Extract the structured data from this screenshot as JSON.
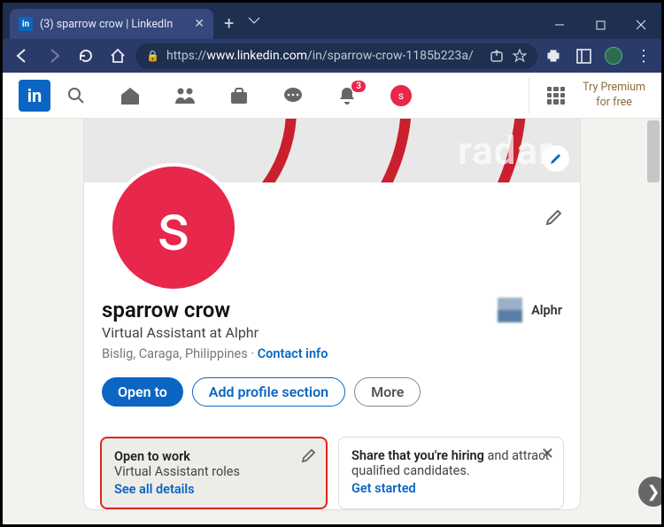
{
  "browser": {
    "tab_title": "(3) sparrow crow | LinkedIn",
    "url_prefix": "https://",
    "url_host": "www.linkedin.com",
    "url_path": "/in/sparrow-crow-1185b223a/"
  },
  "nav": {
    "logo": "in",
    "notification_badge": "3",
    "avatar_letter": "s",
    "premium_line1": "Try Premium",
    "premium_line2": "for free"
  },
  "banner": {
    "watermark": "radar"
  },
  "profile": {
    "avatar_letter": "s",
    "name": "sparrow crow",
    "headline": "Virtual Assistant at Alphr",
    "location": "Bislig, Caraga, Philippines",
    "contact_label": "Contact info",
    "company_name": "Alphr"
  },
  "buttons": {
    "open_to": "Open to",
    "add_section": "Add profile section",
    "more": "More"
  },
  "otw": {
    "title": "Open to work",
    "body": "Virtual Assistant roles",
    "link": "See all details"
  },
  "hiring": {
    "bold": "Share that you're hiring",
    "rest": " and attract qualified candidates.",
    "link": "Get started"
  }
}
